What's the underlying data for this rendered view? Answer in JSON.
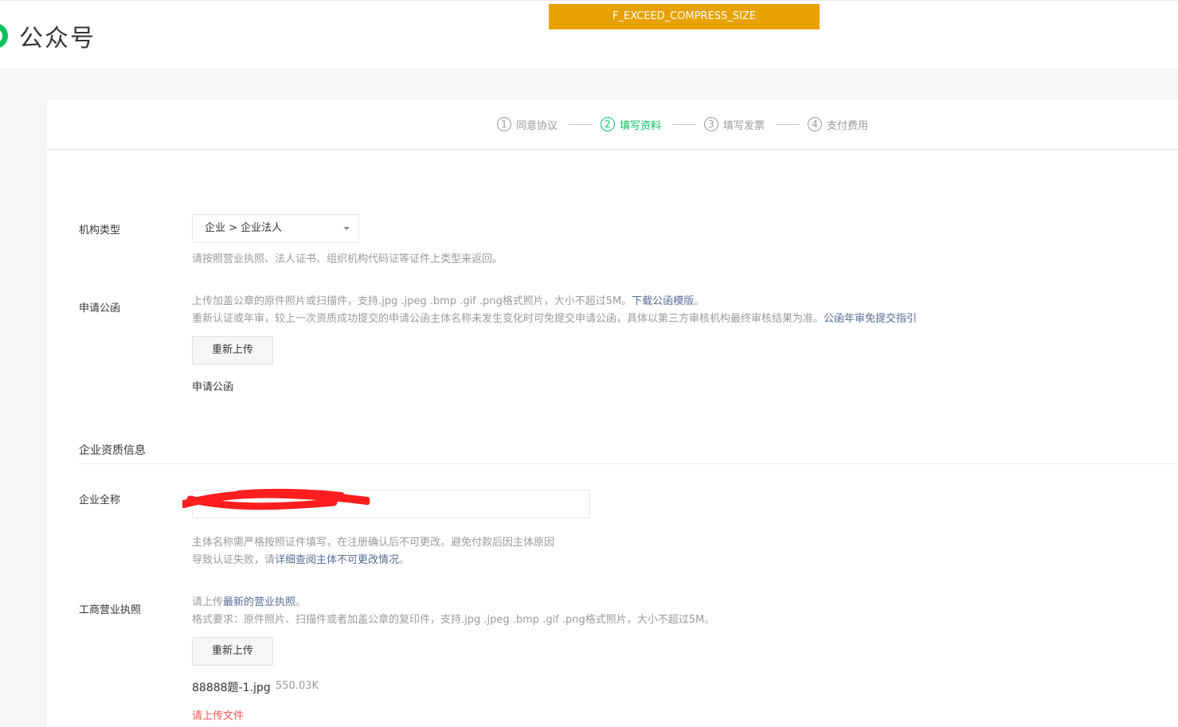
{
  "header": {
    "title": "公众号",
    "error_code": "F_EXCEED_COMPRESS_SIZE"
  },
  "steps": [
    {
      "num": "1",
      "label": "同意协议"
    },
    {
      "num": "2",
      "label": "填写资料"
    },
    {
      "num": "3",
      "label": "填写发票"
    },
    {
      "num": "4",
      "label": "支付费用"
    }
  ],
  "org_type": {
    "label": "机构类型",
    "value": "企业 > 企业法人",
    "tip": "请按照营业执照、法人证书、组织机构代码证等证件上类型来返回。"
  },
  "application_letter": {
    "label": "申请公函",
    "tip1": "上传加盖公章的原件照片或扫描件，支持.jpg .jpeg .bmp .gif .png格式照片，大小不超过5M。",
    "tip1_link": "下载公函模版",
    "tip1_end": "。",
    "tip2": "重新认证或年审，较上一次资质成功提交的申请公函主体名称未发生变化时可免提交申请公函，具体以第三方审核机构最终审核结果为准。",
    "tip2_link": "公函年审免提交指引",
    "upload_label": "重新上传",
    "file_name": "申请公函"
  },
  "company_section": {
    "title": "企业资质信息"
  },
  "company_name": {
    "label": "企业全称",
    "value": "",
    "tip1": "主体名称需严格按照证件填写，在注册确认后不可更改。避免付款后因主体原因",
    "tip2": "导致认证失败，请",
    "tip2_link": "详细查阅主体不可更改情况",
    "tip2_end": "。"
  },
  "license": {
    "label": "工商营业执照",
    "tip1": "请上传",
    "tip1_link": "最新的营业执照",
    "tip1_end": "。",
    "tip2": "格式要求：原件照片、扫描件或者加盖公章的复印件，支持.jpg .jpeg .bmp .gif .png格式照片，大小不超过5M。",
    "upload_label": "重新上传",
    "file_name": "88888题-1.jpg",
    "file_size": "550.03K",
    "error": "请上传文件"
  },
  "colors": {
    "accent": "#07c160",
    "link": "#576b95",
    "error": "#fa5151",
    "banner": "#e7a100"
  }
}
